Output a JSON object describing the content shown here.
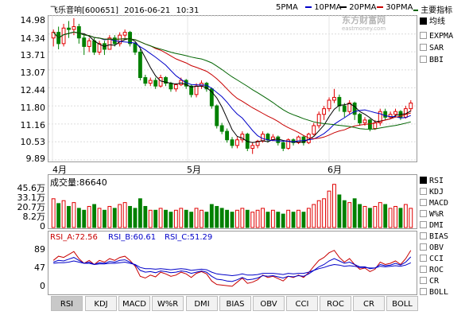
{
  "header": {
    "stock": "飞乐音响[600651]",
    "date": "2016-06-21",
    "time": "10:31"
  },
  "ma_legend": [
    {
      "label": "5PMA",
      "color": "#000000"
    },
    {
      "label": "10PMA",
      "color": "#0000c8"
    },
    {
      "label": "20PMA",
      "color": "#c80000"
    },
    {
      "label": "30PMA",
      "color": "#006400"
    }
  ],
  "main_indicator_label": "主要指标",
  "watermark": {
    "cn": "东方财富网",
    "en": "eastmoney.com"
  },
  "side_menu_main": [
    {
      "label": "均线",
      "checked": true
    },
    {
      "label": "EXPMA",
      "checked": false
    },
    {
      "label": "SAR",
      "checked": false
    },
    {
      "label": "BBI",
      "checked": false
    }
  ],
  "price_axis": [
    "14.98",
    "14.34",
    "13.71",
    "13.07",
    "12.44",
    "11.80",
    "11.16",
    "10.53",
    "9.89"
  ],
  "month_labels": [
    "4月",
    "5月",
    "6月"
  ],
  "volume_title": "成交量:86640",
  "volume_axis": [
    "45.6万",
    "33.1万",
    "20.7万",
    "8.2万",
    "0"
  ],
  "side_menu_lower": [
    {
      "label": "RSI",
      "checked": true
    },
    {
      "label": "KDJ",
      "checked": false
    },
    {
      "label": "MACD",
      "checked": false
    },
    {
      "label": "W%R",
      "checked": false
    },
    {
      "label": "DMI",
      "checked": false
    },
    {
      "label": "BIAS",
      "checked": false
    },
    {
      "label": "OBV",
      "checked": false
    },
    {
      "label": "CCI",
      "checked": false
    },
    {
      "label": "ROC",
      "checked": false
    },
    {
      "label": "CR",
      "checked": false
    },
    {
      "label": "BOLL",
      "checked": false
    }
  ],
  "rsi_legend": [
    {
      "label": "RSI_A:72.56",
      "color": "#c80000"
    },
    {
      "label": "RSI_B:60.61",
      "color": "#0000c8"
    },
    {
      "label": "RSI_C:51.29",
      "color": "#0000c8"
    }
  ],
  "rsi_axis": [
    "89",
    "47",
    "0"
  ],
  "tabs": [
    "RSI",
    "KDJ",
    "MACD",
    "W%R",
    "DMI",
    "BIAS",
    "OBV",
    "CCI",
    "ROC",
    "CR",
    "BOLL"
  ],
  "active_tab": "RSI",
  "colors": {
    "up": "#e00000",
    "down": "#008000",
    "frame": "#999999"
  },
  "chart_data": {
    "type": "candlestick",
    "price_range": [
      9.89,
      14.98
    ],
    "candles": [
      [
        14.2,
        14.4,
        14.5,
        13.9
      ],
      [
        14.4,
        14.0,
        14.6,
        13.8
      ],
      [
        14.0,
        14.55,
        14.7,
        13.9
      ],
      [
        14.55,
        14.5,
        14.8,
        14.2
      ],
      [
        14.5,
        14.6,
        14.9,
        14.3
      ],
      [
        14.6,
        14.2,
        14.7,
        14.0
      ],
      [
        14.2,
        13.9,
        14.3,
        13.6
      ],
      [
        13.9,
        14.1,
        14.2,
        13.7
      ],
      [
        14.1,
        13.7,
        14.2,
        13.6
      ],
      [
        13.7,
        14.0,
        14.1,
        13.6
      ],
      [
        14.0,
        13.8,
        14.1,
        13.6
      ],
      [
        13.8,
        14.2,
        14.3,
        13.8
      ],
      [
        14.2,
        14.0,
        14.3,
        13.9
      ],
      [
        14.0,
        14.3,
        14.4,
        13.9
      ],
      [
        14.3,
        14.4,
        14.5,
        14.2
      ],
      [
        14.4,
        14.0,
        14.45,
        13.9
      ],
      [
        14.0,
        13.7,
        14.05,
        13.6
      ],
      [
        13.7,
        12.8,
        13.8,
        12.7
      ],
      [
        12.8,
        12.6,
        12.9,
        12.5
      ],
      [
        12.6,
        12.7,
        12.8,
        12.5
      ],
      [
        12.7,
        12.5,
        12.8,
        12.4
      ],
      [
        12.5,
        12.8,
        12.9,
        12.45
      ],
      [
        12.8,
        12.6,
        12.85,
        12.5
      ],
      [
        12.6,
        12.4,
        12.65,
        12.3
      ],
      [
        12.4,
        12.55,
        12.6,
        12.3
      ],
      [
        12.55,
        12.7,
        12.8,
        12.5
      ],
      [
        12.7,
        12.5,
        12.75,
        12.4
      ],
      [
        12.5,
        12.2,
        12.55,
        12.1
      ],
      [
        12.2,
        12.5,
        12.6,
        12.1
      ],
      [
        12.5,
        12.6,
        12.7,
        12.4
      ],
      [
        12.6,
        12.4,
        12.65,
        12.3
      ],
      [
        12.4,
        11.8,
        12.45,
        11.7
      ],
      [
        11.8,
        11.1,
        11.85,
        11.0
      ],
      [
        11.1,
        10.9,
        11.2,
        10.8
      ],
      [
        10.9,
        10.6,
        11.0,
        10.5
      ],
      [
        10.6,
        10.4,
        10.7,
        10.3
      ],
      [
        10.4,
        10.6,
        10.7,
        10.3
      ],
      [
        10.6,
        10.8,
        10.9,
        10.5
      ],
      [
        10.8,
        10.3,
        10.85,
        10.2
      ],
      [
        10.3,
        10.4,
        10.5,
        10.1
      ],
      [
        10.4,
        10.55,
        10.6,
        10.3
      ],
      [
        10.55,
        10.8,
        10.9,
        10.5
      ],
      [
        10.8,
        10.6,
        10.85,
        10.5
      ],
      [
        10.6,
        10.7,
        10.8,
        10.55
      ],
      [
        10.7,
        10.5,
        10.75,
        10.4
      ],
      [
        10.5,
        10.3,
        10.55,
        10.2
      ],
      [
        10.3,
        10.6,
        10.65,
        10.25
      ],
      [
        10.6,
        10.5,
        10.65,
        10.4
      ],
      [
        10.5,
        10.7,
        10.75,
        10.45
      ],
      [
        10.7,
        10.5,
        10.75,
        10.4
      ],
      [
        10.5,
        10.8,
        10.85,
        10.45
      ],
      [
        10.8,
        11.1,
        11.2,
        10.75
      ],
      [
        11.1,
        11.5,
        11.6,
        11.0
      ],
      [
        11.5,
        11.7,
        11.8,
        11.3
      ],
      [
        11.7,
        12.0,
        12.1,
        11.6
      ],
      [
        12.0,
        12.1,
        12.4,
        11.9
      ],
      [
        12.1,
        11.8,
        12.2,
        11.6
      ],
      [
        11.8,
        11.6,
        11.9,
        11.4
      ],
      [
        11.6,
        11.9,
        12.0,
        11.5
      ],
      [
        11.9,
        11.5,
        11.95,
        11.3
      ],
      [
        11.5,
        11.2,
        11.55,
        11.1
      ],
      [
        11.2,
        11.3,
        11.4,
        11.1
      ],
      [
        11.3,
        11.0,
        11.35,
        10.9
      ],
      [
        11.0,
        11.2,
        11.3,
        10.95
      ],
      [
        11.2,
        11.6,
        11.7,
        11.1
      ],
      [
        11.6,
        11.4,
        11.7,
        11.3
      ],
      [
        11.4,
        11.5,
        11.6,
        11.35
      ],
      [
        11.5,
        11.6,
        11.7,
        11.4
      ],
      [
        11.6,
        11.4,
        11.65,
        11.3
      ],
      [
        11.4,
        11.7,
        11.8,
        11.35
      ],
      [
        11.7,
        11.9,
        12.0,
        11.6
      ]
    ],
    "volume_max": 45.6,
    "volumes": [
      30,
      25,
      28,
      22,
      26,
      20,
      18,
      22,
      24,
      20,
      18,
      22,
      20,
      24,
      26,
      22,
      20,
      30,
      22,
      18,
      18,
      20,
      18,
      16,
      18,
      20,
      18,
      16,
      20,
      18,
      16,
      24,
      22,
      20,
      18,
      16,
      18,
      20,
      18,
      16,
      18,
      20,
      16,
      18,
      16,
      14,
      18,
      16,
      18,
      16,
      20,
      24,
      28,
      30,
      38,
      45,
      34,
      28,
      26,
      30,
      24,
      22,
      20,
      22,
      26,
      24,
      20,
      22,
      20,
      24,
      20
    ],
    "rsi_values": {
      "RSI_A": [
        55,
        62,
        60,
        65,
        70,
        58,
        50,
        55,
        48,
        55,
        52,
        58,
        55,
        60,
        62,
        55,
        45,
        28,
        25,
        30,
        27,
        35,
        32,
        28,
        30,
        35,
        32,
        26,
        33,
        36,
        32,
        20,
        14,
        13,
        12,
        11,
        18,
        25,
        16,
        18,
        22,
        30,
        26,
        28,
        24,
        20,
        28,
        26,
        30,
        26,
        34,
        45,
        55,
        60,
        68,
        72,
        60,
        52,
        58,
        48,
        40,
        42,
        36,
        40,
        52,
        48,
        50,
        54,
        48,
        58,
        72
      ],
      "RSI_B": [
        52,
        55,
        54,
        57,
        60,
        55,
        50,
        52,
        48,
        51,
        50,
        53,
        52,
        55,
        56,
        52,
        47,
        38,
        35,
        36,
        34,
        37,
        36,
        34,
        35,
        37,
        36,
        33,
        35,
        37,
        35,
        28,
        23,
        22,
        20,
        19,
        22,
        26,
        22,
        23,
        25,
        29,
        28,
        29,
        27,
        25,
        28,
        27,
        29,
        28,
        32,
        38,
        44,
        48,
        54,
        58,
        54,
        50,
        52,
        48,
        44,
        44,
        41,
        42,
        48,
        46,
        47,
        50,
        47,
        52,
        61
      ],
      "RSI_C": [
        50,
        51,
        51,
        52,
        54,
        52,
        50,
        50,
        48,
        49,
        49,
        50,
        50,
        51,
        52,
        50,
        48,
        43,
        41,
        41,
        40,
        41,
        40,
        39,
        40,
        41,
        40,
        38,
        39,
        40,
        39,
        35,
        32,
        31,
        30,
        29,
        30,
        32,
        30,
        30,
        31,
        33,
        33,
        33,
        32,
        31,
        33,
        32,
        33,
        33,
        35,
        38,
        41,
        43,
        46,
        48,
        47,
        45,
        46,
        45,
        43,
        43,
        42,
        42,
        45,
        44,
        45,
        46,
        45,
        47,
        51
      ]
    }
  }
}
